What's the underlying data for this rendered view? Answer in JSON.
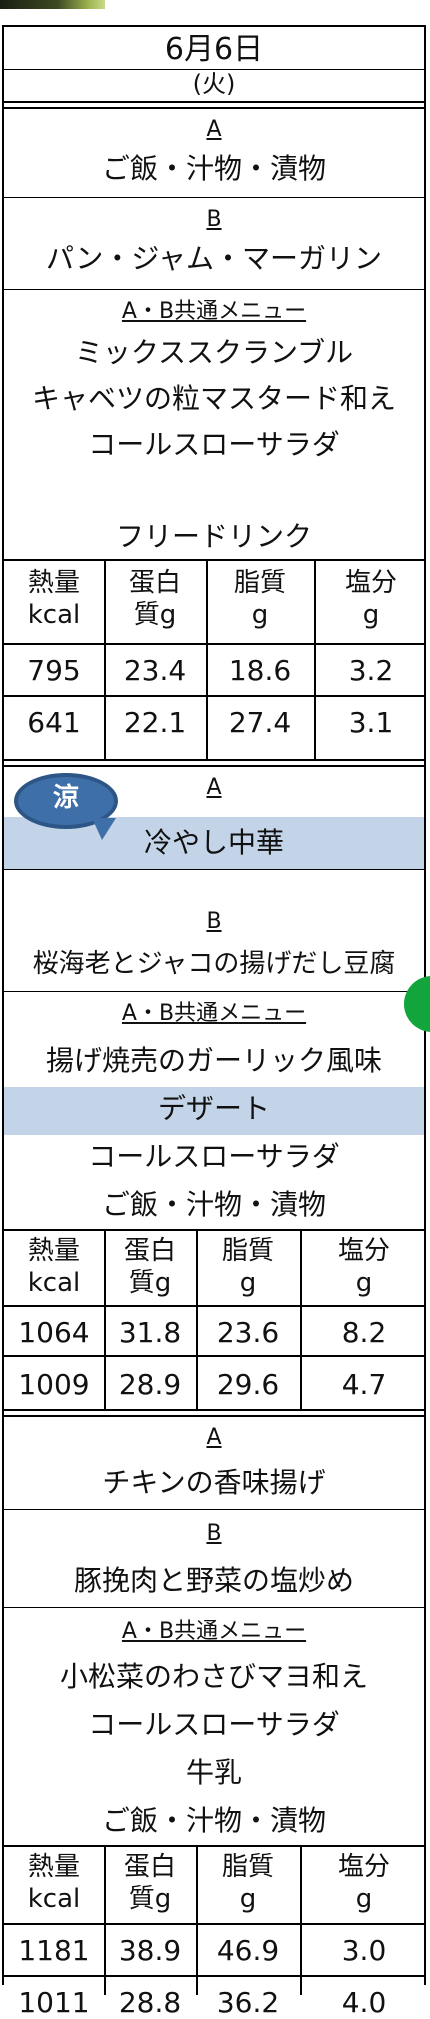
{
  "date": {
    "title": "6月6日",
    "weekday": "(火)"
  },
  "header_row": [
    "熱量\nkcal",
    "蛋白\n質g",
    "脂質\ng",
    "塩分\ng"
  ],
  "days": [
    {
      "a_label": "A",
      "a_items": [
        "ご飯・汁物・漬物"
      ],
      "b_label": "B",
      "b_items": [
        "パン・ジャム・マーガリン"
      ],
      "common_label": "A・B共通メニュー",
      "common_items": [
        "ミックススクランブル",
        "キャベツの粒マスタード和え",
        "コールスローサラダ",
        "",
        "フリードリンク"
      ],
      "nutrition": [
        [
          "795",
          "23.4",
          "18.6",
          "3.2"
        ],
        [
          "641",
          "22.1",
          "27.4",
          "3.1"
        ]
      ]
    },
    {
      "badge": "涼",
      "a_label": "A",
      "a_items": [
        "冷やし中華"
      ],
      "b_label": "B",
      "b_items": [
        "桜海老とジャコの揚げだし豆腐"
      ],
      "common_label": "A・B共通メニュー",
      "common_items": [
        "揚げ焼売のガーリック風味",
        "デザート",
        "コールスローサラダ",
        "ご飯・汁物・漬物"
      ],
      "nutrition": [
        [
          "1064",
          "31.8",
          "23.6",
          "8.2"
        ],
        [
          "1009",
          "28.9",
          "29.6",
          "4.7"
        ]
      ]
    },
    {
      "a_label": "A",
      "a_items": [
        "チキンの香味揚げ"
      ],
      "b_label": "B",
      "b_items": [
        "豚挽肉と野菜の塩炒め"
      ],
      "common_label": "A・B共通メニュー",
      "common_items": [
        "小松菜のわさびマヨ和え",
        "コールスローサラダ",
        "牛乳",
        "ご飯・汁物・漬物"
      ],
      "nutrition": [
        [
          "1181",
          "38.9",
          "46.9",
          "3.0"
        ],
        [
          "1011",
          "28.8",
          "36.2",
          "4.0"
        ]
      ]
    }
  ],
  "colors": {
    "highlight_band": "#c4d4e8",
    "badge": "#3f6fa8",
    "edge_marker": "#11a53b"
  }
}
